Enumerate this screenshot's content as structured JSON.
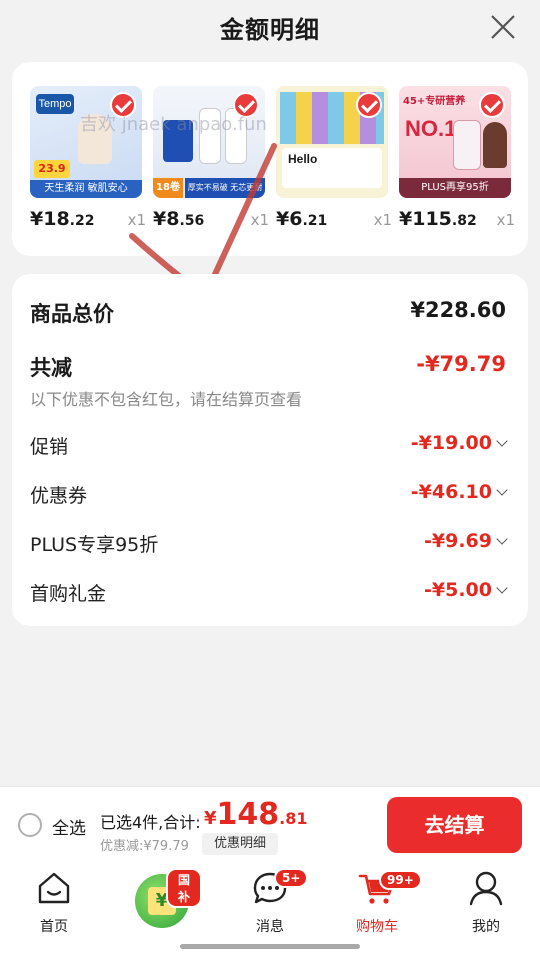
{
  "header": {
    "title": "金额明细"
  },
  "products": [
    {
      "price_int": "¥18",
      "price_dec": ".22",
      "qty": "x1",
      "img_text": "Tempo",
      "img_badge": "23.9",
      "img_caption": "天生柔润 敏肌安心",
      "bg": "#dfe9f7"
    },
    {
      "price_int": "¥8",
      "price_dec": ".56",
      "qty": "x1",
      "img_text": "",
      "img_badge": "18卷",
      "img_caption": "厚实不易破 无芯更耐用",
      "bg": "#e9eef8"
    },
    {
      "price_int": "¥6",
      "price_dec": ".21",
      "qty": "x1",
      "img_text": "Hello",
      "img_badge": "",
      "img_caption": "",
      "bg": "#f5eec4"
    },
    {
      "price_int": "¥115",
      "price_dec": ".82",
      "qty": "x1",
      "img_text": "45+专研营养",
      "img_badge": "NO.1",
      "img_caption": "PLUS再享95折",
      "bg": "#f6d4dc"
    }
  ],
  "watermark": "吉欢 jnaek anpao.fun",
  "summary": {
    "total_label": "商品总价",
    "total_value": "¥228.60",
    "reduce_label": "共减",
    "reduce_value": "-¥79.79",
    "note": "以下优惠不包含红包，请在结算页查看",
    "items": [
      {
        "label": "促销",
        "value": "-¥19.00"
      },
      {
        "label": "优惠券",
        "value": "-¥46.10"
      },
      {
        "label": "PLUS专享95折",
        "value": "-¥9.69"
      },
      {
        "label": "首购礼金",
        "value": "-¥5.00"
      }
    ]
  },
  "checkout": {
    "select_all": "全选",
    "selected_text": "已选4件,合计:",
    "total_cur": "¥",
    "total_int": "148",
    "total_dec": ".81",
    "reduce": "优惠减:¥79.79",
    "detail_button": "优惠明细",
    "pay_button": "去结算"
  },
  "tabs": [
    {
      "label": "首页",
      "badge": ""
    },
    {
      "label": "",
      "badge": "国补"
    },
    {
      "label": "消息",
      "badge": "5+"
    },
    {
      "label": "购物车",
      "badge": "99+"
    },
    {
      "label": "我的",
      "badge": ""
    }
  ],
  "colors": {
    "accent": "#e3291f",
    "pay": "#ea2c2c",
    "checkmark_overlay": "#c23a32"
  }
}
